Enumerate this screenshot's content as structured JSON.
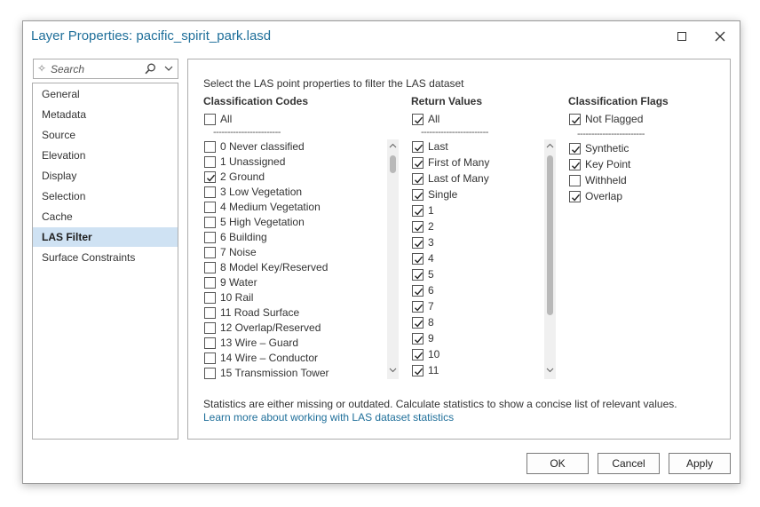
{
  "window": {
    "title": "Layer Properties: pacific_spirit_park.lasd"
  },
  "search": {
    "placeholder": "Search"
  },
  "nav": {
    "items": [
      "General",
      "Metadata",
      "Source",
      "Elevation",
      "Display",
      "Selection",
      "Cache",
      "LAS Filter",
      "Surface Constraints"
    ],
    "active": "LAS Filter"
  },
  "panel": {
    "intro": "Select the LAS point properties to filter the LAS dataset",
    "separator": "------------------------",
    "classification_codes": {
      "header": "Classification Codes",
      "all": {
        "label": "All",
        "checked": false
      },
      "items": [
        {
          "label": "0 Never classified",
          "checked": false
        },
        {
          "label": "1 Unassigned",
          "checked": false
        },
        {
          "label": "2 Ground",
          "checked": true
        },
        {
          "label": "3 Low Vegetation",
          "checked": false
        },
        {
          "label": "4 Medium Vegetation",
          "checked": false
        },
        {
          "label": "5 High Vegetation",
          "checked": false
        },
        {
          "label": "6 Building",
          "checked": false
        },
        {
          "label": "7 Noise",
          "checked": false
        },
        {
          "label": "8 Model Key/Reserved",
          "checked": false
        },
        {
          "label": "9 Water",
          "checked": false
        },
        {
          "label": "10 Rail",
          "checked": false
        },
        {
          "label": "11 Road Surface",
          "checked": false
        },
        {
          "label": "12 Overlap/Reserved",
          "checked": false
        },
        {
          "label": "13 Wire – Guard",
          "checked": false
        },
        {
          "label": "14 Wire – Conductor",
          "checked": false
        },
        {
          "label": "15 Transmission Tower",
          "checked": false
        }
      ]
    },
    "return_values": {
      "header": "Return Values",
      "all": {
        "label": "All",
        "checked": true
      },
      "items": [
        {
          "label": "Last",
          "checked": true
        },
        {
          "label": "First of Many",
          "checked": true
        },
        {
          "label": "Last of Many",
          "checked": true
        },
        {
          "label": "Single",
          "checked": true
        },
        {
          "label": "1",
          "checked": true
        },
        {
          "label": "2",
          "checked": true
        },
        {
          "label": "3",
          "checked": true
        },
        {
          "label": "4",
          "checked": true
        },
        {
          "label": "5",
          "checked": true
        },
        {
          "label": "6",
          "checked": true
        },
        {
          "label": "7",
          "checked": true
        },
        {
          "label": "8",
          "checked": true
        },
        {
          "label": "9",
          "checked": true
        },
        {
          "label": "10",
          "checked": true
        },
        {
          "label": "11",
          "checked": true
        }
      ]
    },
    "classification_flags": {
      "header": "Classification Flags",
      "all": {
        "label": "Not Flagged",
        "checked": true
      },
      "items": [
        {
          "label": "Synthetic",
          "checked": true
        },
        {
          "label": "Key Point",
          "checked": true
        },
        {
          "label": "Withheld",
          "checked": false
        },
        {
          "label": "Overlap",
          "checked": true
        }
      ]
    },
    "stats_message": "Statistics are either missing or outdated. Calculate statistics to show a concise list of relevant values.",
    "stats_link": "Learn more about working with LAS dataset statistics"
  },
  "buttons": {
    "ok": "OK",
    "cancel": "Cancel",
    "apply": "Apply"
  },
  "colors": {
    "accent": "#1f6f9a",
    "selection": "#cfe2f3"
  }
}
